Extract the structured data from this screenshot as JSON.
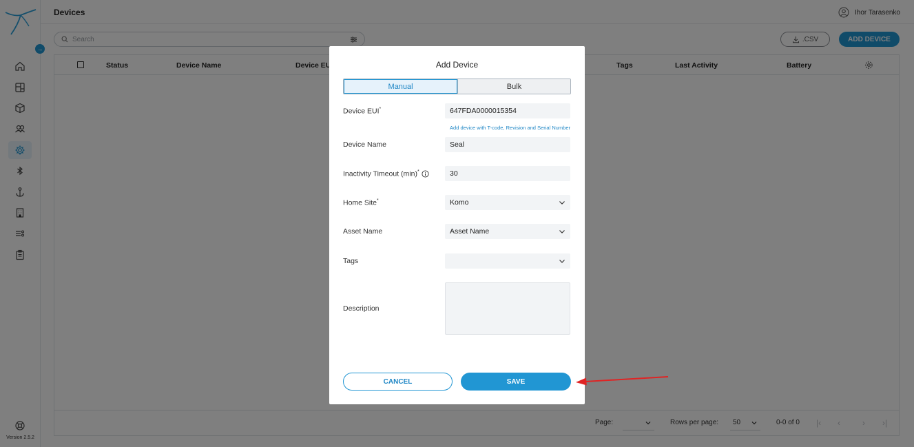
{
  "sidebar": {
    "version": "Version 2.5.2",
    "items": [
      {
        "name": "home-icon"
      },
      {
        "name": "dashboard-icon"
      },
      {
        "name": "box-icon"
      },
      {
        "name": "users-icon"
      },
      {
        "name": "gear-icon",
        "active": true
      },
      {
        "name": "bluetooth-icon"
      },
      {
        "name": "anchor-icon"
      },
      {
        "name": "building-icon"
      },
      {
        "name": "list-settings-icon"
      },
      {
        "name": "clipboard-icon"
      }
    ]
  },
  "header": {
    "title": "Devices",
    "user": "Ihor Tarasenko"
  },
  "toolbar": {
    "search_placeholder": "Search",
    "csv_label": ".CSV",
    "add_device_label": "ADD DEVICE"
  },
  "table": {
    "columns": [
      "Status",
      "Device Name",
      "Device EUI",
      "Tags",
      "Last Activity",
      "Battery"
    ]
  },
  "pagination": {
    "page_label": "Page:",
    "page_value": "",
    "rows_label": "Rows per page:",
    "rows_value": "50",
    "range": "0-0 of 0"
  },
  "modal": {
    "title": "Add Device",
    "tabs": [
      "Manual",
      "Bulk"
    ],
    "active_tab": "Manual",
    "fields": {
      "device_eui": {
        "label": "Device EUI",
        "required": "*",
        "value": "647FDA0000015354"
      },
      "eui_help": "Add device with T-code, Revision and Serial Number",
      "device_name": {
        "label": "Device Name",
        "value": "Seal"
      },
      "inactivity_timeout": {
        "label": "Inactivity Timeout (min)",
        "required": "*",
        "value": "30"
      },
      "home_site": {
        "label": "Home Site",
        "required": "*",
        "value": "Komo"
      },
      "asset_name": {
        "label": "Asset Name",
        "value": "Asset Name"
      },
      "tags": {
        "label": "Tags",
        "value": ""
      },
      "description": {
        "label": "Description",
        "value": ""
      }
    },
    "cancel_label": "CANCEL",
    "save_label": "SAVE"
  },
  "colors": {
    "accent": "#2196d3",
    "annotation_arrow": "#e02424"
  }
}
